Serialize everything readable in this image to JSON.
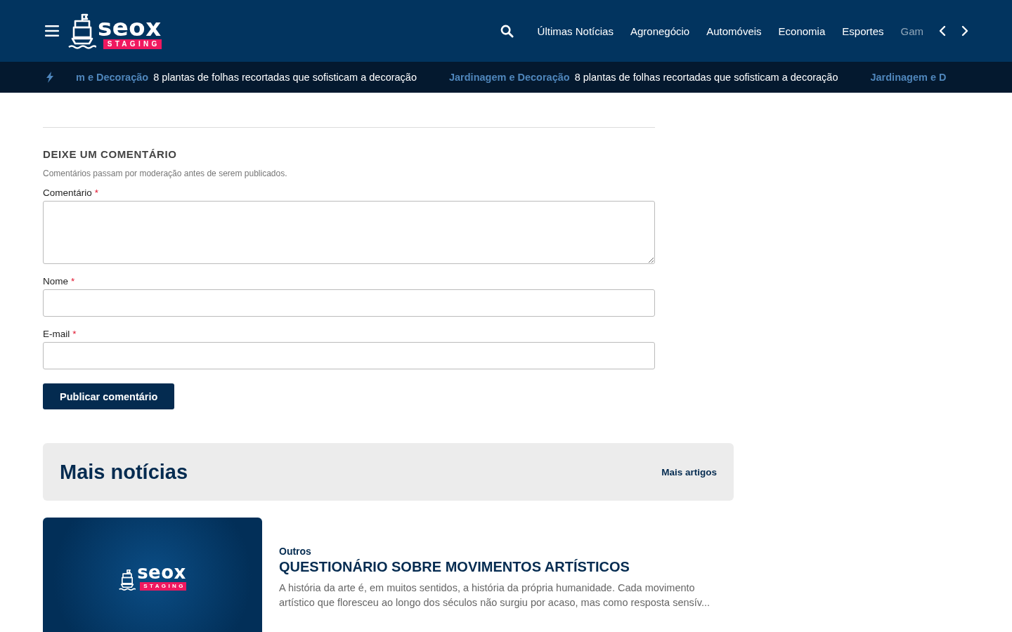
{
  "header": {
    "logo": {
      "name": "seox",
      "badge": "STAGING"
    },
    "nav": [
      {
        "label": "Últimas Notícias",
        "faded": false
      },
      {
        "label": "Agronegócio",
        "faded": false
      },
      {
        "label": "Automóveis",
        "faded": false
      },
      {
        "label": "Economia",
        "faded": false
      },
      {
        "label": "Esportes",
        "faded": false
      },
      {
        "label": "Gam",
        "faded": true
      }
    ]
  },
  "ticker": [
    {
      "kind": "category",
      "text": "m e Decoração"
    },
    {
      "kind": "headline",
      "text": "8 plantas de folhas recortadas que sofisticam a decoração"
    },
    {
      "kind": "category",
      "text": "Jardinagem e Decoração"
    },
    {
      "kind": "headline",
      "text": "8 plantas de folhas recortadas que sofisticam a decoração"
    },
    {
      "kind": "category",
      "text": "Jardinagem e D"
    }
  ],
  "comment_form": {
    "title": "DEIXE UM COMENTÁRIO",
    "note": "Comentários passam por moderação antes de serem publicados.",
    "fields": [
      {
        "kind": "textarea",
        "label": "Comentário",
        "required_mark": "*"
      },
      {
        "kind": "input",
        "label": "Nome",
        "required_mark": "*"
      },
      {
        "kind": "input",
        "label": "E-mail",
        "required_mark": "*"
      }
    ],
    "submit": "Publicar comentário"
  },
  "more_news": {
    "title": "Mais notícias",
    "link": "Mais artigos",
    "articles": [
      {
        "thumbnail": {
          "name": "seox",
          "badge": "STAGING"
        },
        "category": "Outros",
        "title": "QUESTIONÁRIO SOBRE MOVIMENTOS ARTÍSTICOS",
        "excerpt": "A história da arte é, em muitos sentidos, a história da própria humanidade. Cada movimento artístico que floresceu ao longo dos séculos não surgiu por acaso, mas como resposta sensív..."
      }
    ]
  }
}
